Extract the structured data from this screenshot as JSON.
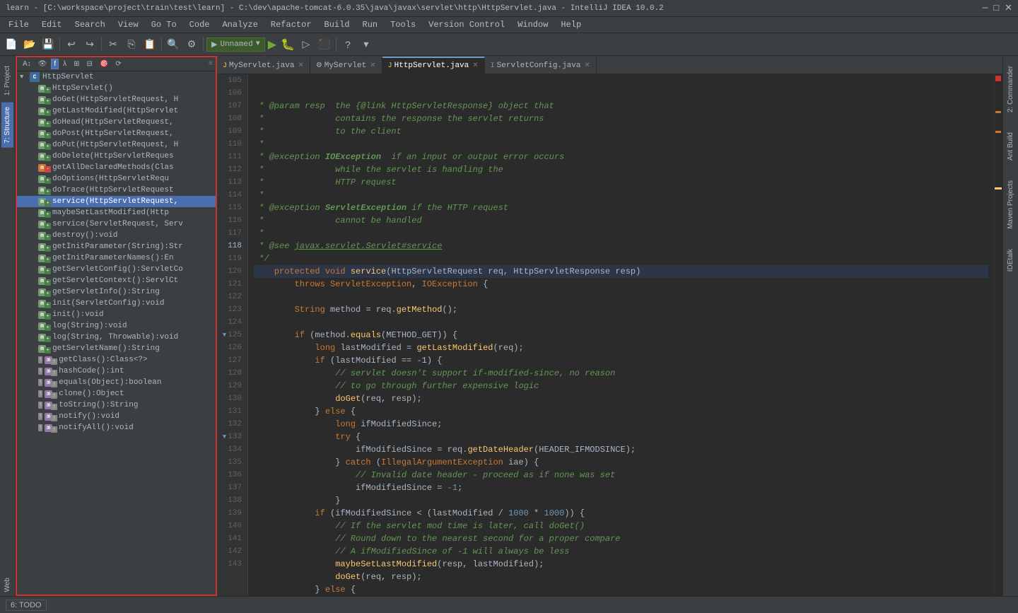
{
  "titleBar": {
    "text": "learn - [C:\\workspace\\project\\train\\test\\learn] - C:\\dev\\apache-tomcat-6.0.35\\java\\javax\\servlet\\http\\HttpServlet.java - IntelliJ IDEA 10.0.2"
  },
  "menuBar": {
    "items": [
      "File",
      "Edit",
      "Search",
      "View",
      "Go To",
      "Code",
      "Analyze",
      "Refactor",
      "Build",
      "Run",
      "Tools",
      "Version Control",
      "Window",
      "Help"
    ]
  },
  "tabs": [
    {
      "label": "MyServlet.java",
      "icon": "J",
      "active": false,
      "closable": true
    },
    {
      "label": "MyServlet",
      "icon": "⚙",
      "active": false,
      "closable": true
    },
    {
      "label": "HttpServlet.java",
      "icon": "J",
      "active": true,
      "closable": true
    },
    {
      "label": "ServletConfig.java",
      "icon": "I",
      "active": false,
      "closable": true
    }
  ],
  "sidebar": {
    "title": "Structure",
    "nodes": [
      {
        "indent": 0,
        "label": "HttpServlet",
        "type": "class",
        "expanded": true
      },
      {
        "indent": 1,
        "label": "HttpServlet()",
        "type": "method"
      },
      {
        "indent": 1,
        "label": "doGet(HttpServletRequest, H",
        "type": "method"
      },
      {
        "indent": 1,
        "label": "getLastModified(HttpServlet",
        "type": "method"
      },
      {
        "indent": 1,
        "label": "doHead(HttpServletRequest,",
        "type": "method"
      },
      {
        "indent": 1,
        "label": "doPost(HttpServletRequest,",
        "type": "method"
      },
      {
        "indent": 1,
        "label": "doPut(HttpServletRequest, H",
        "type": "method"
      },
      {
        "indent": 1,
        "label": "doDelete(HttpServletReques",
        "type": "method"
      },
      {
        "indent": 1,
        "label": "getAllDeclaredMethods(Clas",
        "type": "method-private"
      },
      {
        "indent": 1,
        "label": "doOptions(HttpServletRequ",
        "type": "method"
      },
      {
        "indent": 1,
        "label": "doTrace(HttpServletRequest",
        "type": "method"
      },
      {
        "indent": 1,
        "label": "service(HttpServletRequest,",
        "type": "method-selected"
      },
      {
        "indent": 1,
        "label": "maybeSetLastModified(Http",
        "type": "method"
      },
      {
        "indent": 1,
        "label": "service(ServletRequest, Serv",
        "type": "method"
      },
      {
        "indent": 1,
        "label": "destroy():void",
        "type": "method"
      },
      {
        "indent": 1,
        "label": "getInitParameter(String):Str",
        "type": "method"
      },
      {
        "indent": 1,
        "label": "getInitParameterNames():En",
        "type": "method"
      },
      {
        "indent": 1,
        "label": "getServletConfig():ServletCo",
        "type": "method"
      },
      {
        "indent": 1,
        "label": "getServletContext():ServlCt",
        "type": "method"
      },
      {
        "indent": 1,
        "label": "getServletInfo():String",
        "type": "method"
      },
      {
        "indent": 1,
        "label": "init(ServletConfig):void",
        "type": "method"
      },
      {
        "indent": 1,
        "label": "init():void",
        "type": "method"
      },
      {
        "indent": 1,
        "label": "log(String):void",
        "type": "method"
      },
      {
        "indent": 1,
        "label": "log(String, Throwable):void",
        "type": "method"
      },
      {
        "indent": 1,
        "label": "getServletName():String",
        "type": "method"
      },
      {
        "indent": 1,
        "label": "getClass():Class<?>",
        "type": "method-inherited"
      },
      {
        "indent": 1,
        "label": "hashCode():int",
        "type": "method-inherited"
      },
      {
        "indent": 1,
        "label": "equals(Object):boolean",
        "type": "method-inherited"
      },
      {
        "indent": 1,
        "label": "clone():Object",
        "type": "method-inherited"
      },
      {
        "indent": 1,
        "label": "toString():String",
        "type": "method-inherited"
      },
      {
        "indent": 1,
        "label": "notify():void",
        "type": "method-inherited"
      },
      {
        "indent": 1,
        "label": "notifyAll():void",
        "type": "method-inherited"
      }
    ]
  },
  "sideToolsLeft": [
    {
      "label": "1: Project",
      "active": false
    },
    {
      "label": "7: Structure",
      "active": true
    }
  ],
  "sideToolsRight": [
    {
      "label": "2: Commander"
    },
    {
      "label": "Ant Build"
    },
    {
      "label": "Maven Projects"
    },
    {
      "label": "IDEtalk"
    }
  ],
  "bottomBar": {
    "todoLabel": "6: TODO"
  },
  "runConfig": {
    "label": "Unnamed"
  },
  "codeLines": [
    {
      "num": "",
      "tokens": [
        {
          "t": " * @param resp  the {@link HttpServletResponse} object that",
          "c": "comment"
        }
      ]
    },
    {
      "num": "",
      "tokens": [
        {
          "t": " *              contains the response the servlet returns",
          "c": "comment"
        }
      ]
    },
    {
      "num": "",
      "tokens": [
        {
          "t": " *              to the client",
          "c": "comment"
        }
      ]
    },
    {
      "num": "",
      "tokens": [
        {
          "t": " *",
          "c": "comment"
        }
      ]
    },
    {
      "num": "",
      "tokens": [
        {
          "t": " * @exception ",
          "c": "comment"
        },
        {
          "t": "IOException",
          "c": "comment-tag"
        },
        {
          "t": "  if an input or output error occurs",
          "c": "comment"
        }
      ]
    },
    {
      "num": "",
      "tokens": [
        {
          "t": " *              while the servlet is handling the",
          "c": "comment"
        }
      ]
    },
    {
      "num": "",
      "tokens": [
        {
          "t": " *              HTTP request",
          "c": "comment"
        }
      ]
    },
    {
      "num": "",
      "tokens": [
        {
          "t": " *",
          "c": "comment"
        }
      ]
    },
    {
      "num": "",
      "tokens": [
        {
          "t": " * @exception ",
          "c": "comment"
        },
        {
          "t": "ServletException",
          "c": "comment-tag"
        },
        {
          "t": " if the HTTP request",
          "c": "comment"
        }
      ]
    },
    {
      "num": "",
      "tokens": [
        {
          "t": " *              cannot be handled",
          "c": "comment"
        }
      ]
    },
    {
      "num": "",
      "tokens": [
        {
          "t": " *",
          "c": "comment"
        }
      ]
    },
    {
      "num": "",
      "tokens": [
        {
          "t": " * @see ",
          "c": "comment"
        },
        {
          "t": "javax.servlet.Servlet#service",
          "c": "comment-ref"
        }
      ]
    },
    {
      "num": "",
      "tokens": [
        {
          "t": " */",
          "c": "comment"
        }
      ]
    },
    {
      "num": "active",
      "tokens": [
        {
          "t": "    protected ",
          "c": "kw"
        },
        {
          "t": "void ",
          "c": "kw-type"
        },
        {
          "t": "service",
          "c": "fn"
        },
        {
          "t": "(HttpServletRequest req, HttpServletResponse resp)",
          "c": "var"
        }
      ]
    },
    {
      "num": "",
      "tokens": [
        {
          "t": "        throws ",
          "c": "kw"
        },
        {
          "t": "ServletException",
          "c": "exc"
        },
        {
          "t": ", ",
          "c": "var"
        },
        {
          "t": "IOException",
          "c": "exc"
        },
        {
          "t": " {",
          "c": "var"
        }
      ]
    },
    {
      "num": "",
      "tokens": []
    },
    {
      "num": "",
      "tokens": [
        {
          "t": "        String ",
          "c": "kw-type"
        },
        {
          "t": "method = req.",
          "c": "var"
        },
        {
          "t": "getMethod",
          "c": "method-call"
        },
        {
          "t": "();",
          "c": "var"
        }
      ]
    },
    {
      "num": "",
      "tokens": []
    },
    {
      "num": "",
      "tokens": [
        {
          "t": "        ",
          "c": "var"
        },
        {
          "t": "if ",
          "c": "kw"
        },
        {
          "t": "(method.",
          "c": "var"
        },
        {
          "t": "equals",
          "c": "method-call"
        },
        {
          "t": "(METHOD_GET)) {",
          "c": "var"
        }
      ]
    },
    {
      "num": "",
      "tokens": [
        {
          "t": "            ",
          "c": "var"
        },
        {
          "t": "long ",
          "c": "kw-type"
        },
        {
          "t": "lastModified = ",
          "c": "var"
        },
        {
          "t": "getLastModified",
          "c": "method-call"
        },
        {
          "t": "(req);",
          "c": "var"
        }
      ]
    },
    {
      "num": "fold",
      "tokens": [
        {
          "t": "            ",
          "c": "var"
        },
        {
          "t": "if ",
          "c": "kw"
        },
        {
          "t": "(lastModified == -1) {",
          "c": "var"
        }
      ]
    },
    {
      "num": "",
      "tokens": [
        {
          "t": "                // servlet doesn't support if-modified-since, no reason",
          "c": "comment"
        }
      ]
    },
    {
      "num": "",
      "tokens": [
        {
          "t": "                // to go through further expensive logic",
          "c": "comment"
        }
      ]
    },
    {
      "num": "",
      "tokens": [
        {
          "t": "                ",
          "c": "var"
        },
        {
          "t": "doGet",
          "c": "method-call"
        },
        {
          "t": "(req, resp);",
          "c": "var"
        }
      ]
    },
    {
      "num": "",
      "tokens": [
        {
          "t": "            } ",
          "c": "var"
        },
        {
          "t": "else ",
          "c": "kw"
        },
        {
          "t": "{",
          "c": "var"
        }
      ]
    },
    {
      "num": "",
      "tokens": [
        {
          "t": "                ",
          "c": "var"
        },
        {
          "t": "long ",
          "c": "kw-type"
        },
        {
          "t": "ifModifiedSince;",
          "c": "var"
        }
      ]
    },
    {
      "num": "",
      "tokens": [
        {
          "t": "                ",
          "c": "var"
        },
        {
          "t": "try ",
          "c": "kw"
        },
        {
          "t": "{",
          "c": "var"
        }
      ]
    },
    {
      "num": "",
      "tokens": [
        {
          "t": "                    ifModifiedSince = req.",
          "c": "var"
        },
        {
          "t": "getDateHeader",
          "c": "method-call"
        },
        {
          "t": "(HEADER_IFMODSINCE);",
          "c": "var"
        }
      ]
    },
    {
      "num": "fold",
      "tokens": [
        {
          "t": "                } ",
          "c": "var"
        },
        {
          "t": "catch ",
          "c": "kw"
        },
        {
          "t": "(",
          "c": "var"
        },
        {
          "t": "IllegalArgumentException",
          "c": "exc"
        },
        {
          "t": " iae) {",
          "c": "var"
        }
      ]
    },
    {
      "num": "",
      "tokens": [
        {
          "t": "                    // Invalid date header - proceed as if none was set",
          "c": "comment"
        }
      ]
    },
    {
      "num": "",
      "tokens": [
        {
          "t": "                    ifModifiedSince = ",
          "c": "var"
        },
        {
          "t": "-1",
          "c": "num"
        },
        {
          "t": ";",
          "c": "var"
        }
      ]
    },
    {
      "num": "",
      "tokens": [
        {
          "t": "                }",
          "c": "var"
        }
      ]
    },
    {
      "num": "",
      "tokens": [
        {
          "t": "            ",
          "c": "var"
        },
        {
          "t": "if ",
          "c": "kw"
        },
        {
          "t": "(ifModifiedSince < (lastModified / ",
          "c": "var"
        },
        {
          "t": "1000",
          "c": "num"
        },
        {
          "t": " * ",
          "c": "var"
        },
        {
          "t": "1000",
          "c": "num"
        },
        {
          "t": ")) {",
          "c": "var"
        }
      ]
    },
    {
      "num": "",
      "tokens": [
        {
          "t": "                // If the servlet mod time is later, call doGet()",
          "c": "comment"
        }
      ]
    },
    {
      "num": "",
      "tokens": [
        {
          "t": "                // Round down to the nearest second for a proper compare",
          "c": "comment"
        }
      ]
    },
    {
      "num": "",
      "tokens": [
        {
          "t": "                // A ifModifiedSince of -1 will always be less",
          "c": "comment"
        }
      ]
    },
    {
      "num": "",
      "tokens": [
        {
          "t": "                ",
          "c": "var"
        },
        {
          "t": "maybeSetLastModified",
          "c": "method-call"
        },
        {
          "t": "(resp, lastModified);",
          "c": "var"
        }
      ]
    },
    {
      "num": "",
      "tokens": [
        {
          "t": "                ",
          "c": "var"
        },
        {
          "t": "doGet",
          "c": "method-call"
        },
        {
          "t": "(req, resp);",
          "c": "var"
        }
      ]
    },
    {
      "num": "",
      "tokens": [
        {
          "t": "            } ",
          "c": "var"
        },
        {
          "t": "else ",
          "c": "kw"
        },
        {
          "t": "{",
          "c": "var"
        }
      ]
    }
  ]
}
